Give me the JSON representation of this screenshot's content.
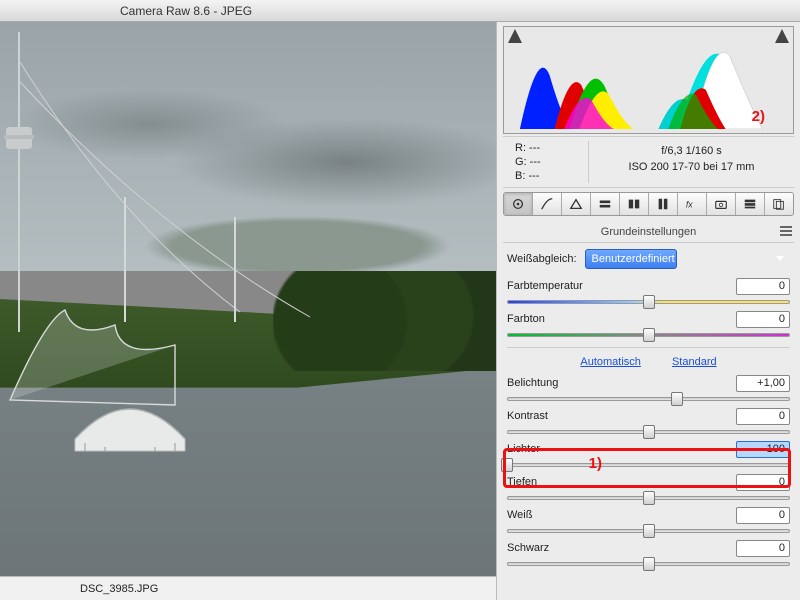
{
  "title": "Camera Raw 8.6 - JPEG",
  "filename": "DSC_3985.JPG",
  "info": {
    "r": "R:   ---",
    "g": "G:   ---",
    "b": "B:   ---",
    "aperture_shutter": "f/6,3   1/160 s",
    "iso_lens": "ISO 200   17-70 bei 17 mm"
  },
  "section": "Grundeinstellungen",
  "wb": {
    "label": "Weißabgleich:",
    "value": "Benutzerdefiniert"
  },
  "sliders": {
    "temp": {
      "label": "Farbtemperatur",
      "value": "0",
      "pos": 50
    },
    "tint": {
      "label": "Farbton",
      "value": "0",
      "pos": 50
    },
    "exposure": {
      "label": "Belichtung",
      "value": "+1,00",
      "pos": 60
    },
    "contrast": {
      "label": "Kontrast",
      "value": "0",
      "pos": 50
    },
    "lights": {
      "label": "Lichter",
      "value": "-100",
      "pos": 0
    },
    "shadows": {
      "label": "Tiefen",
      "value": "0",
      "pos": 50
    },
    "white": {
      "label": "Weiß",
      "value": "0",
      "pos": 50
    },
    "black": {
      "label": "Schwarz",
      "value": "0",
      "pos": 50
    }
  },
  "links": {
    "auto": "Automatisch",
    "standard": "Standard"
  },
  "annotations": {
    "one": "1)",
    "two": "2)"
  }
}
